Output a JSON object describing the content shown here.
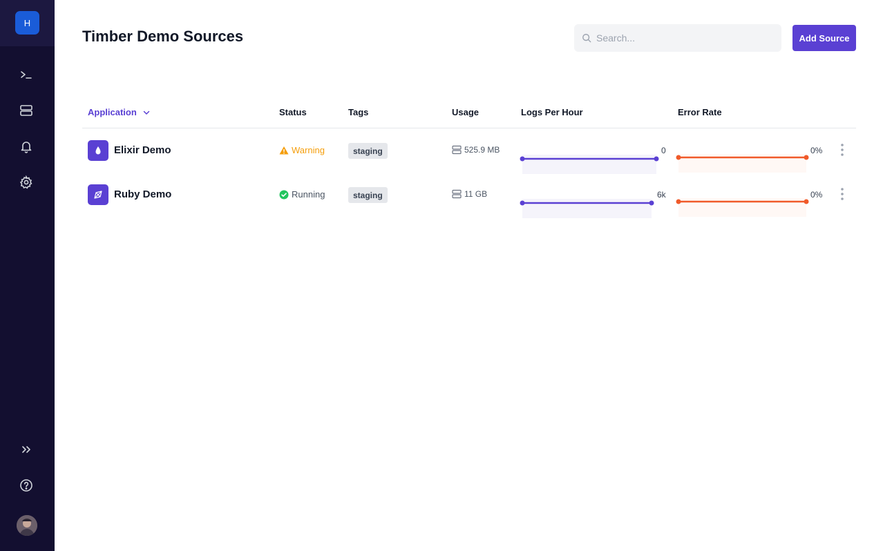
{
  "sidebar": {
    "org_initial": "H",
    "nav": [
      {
        "icon": "terminal-icon"
      },
      {
        "icon": "server-icon"
      },
      {
        "icon": "bell-icon"
      },
      {
        "icon": "gear-icon"
      }
    ],
    "bottom": [
      {
        "icon": "chevrons-right-icon"
      },
      {
        "icon": "help-icon"
      }
    ]
  },
  "header": {
    "title": "Timber Demo Sources",
    "search_placeholder": "Search...",
    "add_button": "Add Source"
  },
  "table": {
    "columns": [
      "Application",
      "Status",
      "Tags",
      "Usage",
      "Logs Per Hour",
      "Error Rate"
    ],
    "rows": [
      {
        "app": "Elixir Demo",
        "app_icon": "elixir-drop-icon",
        "status": "Warning",
        "status_icon": "warning-icon",
        "status_color": "#f59e0b",
        "tag": "staging",
        "usage": "525.9 MB",
        "logs_label": "0",
        "error_label": "0%"
      },
      {
        "app": "Ruby Demo",
        "app_icon": "ruby-gem-icon",
        "status": "Running",
        "status_icon": "check-circle-icon",
        "status_color": "#22c55e",
        "tag": "staging",
        "usage": "11 GB",
        "logs_label": "6k",
        "error_label": "0%"
      }
    ]
  },
  "colors": {
    "accent": "#5a40d3",
    "logs_line": "#5a40d3",
    "error_line": "#f05a2a",
    "sidebar_bg": "#130f30"
  }
}
